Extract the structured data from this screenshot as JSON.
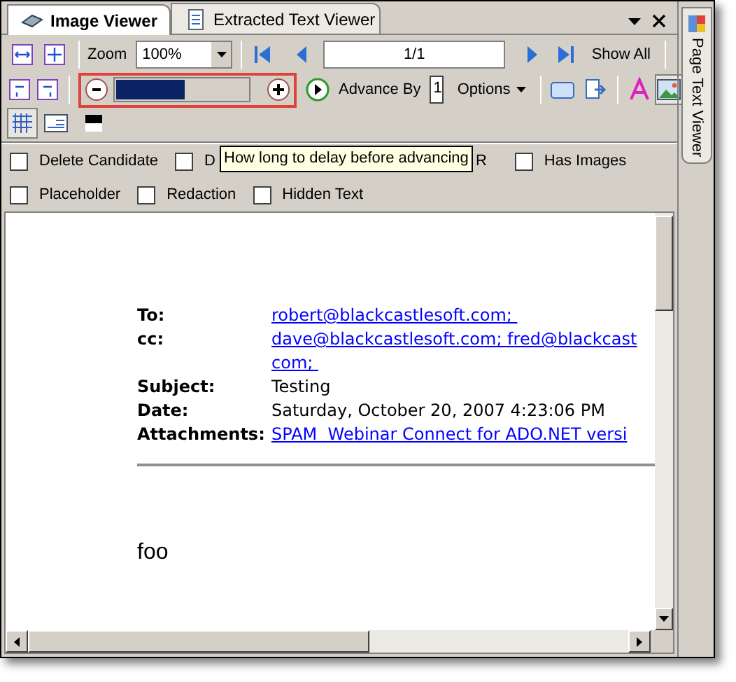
{
  "tabs": [
    {
      "label": "Image Viewer",
      "selected": true
    },
    {
      "label": "Extracted Text Viewer",
      "selected": false
    }
  ],
  "toolbar": {
    "zoom_label": "Zoom",
    "zoom_value": "100%",
    "page_value": "1/1",
    "show_all": "Show All",
    "delay": {
      "level": 0.52
    },
    "advance_label": "Advance By",
    "advance_value": "1",
    "options": "Options",
    "image_button": {
      "selected": true
    }
  },
  "tooltip": "How long to delay before advancing",
  "filter_rows": [
    [
      {
        "kind": "checkbox",
        "label": "Delete Candidate",
        "checked": false
      },
      {
        "kind": "checkbox",
        "label": "D",
        "checked": false
      },
      {
        "kind": "fragment",
        "label": "R"
      },
      {
        "kind": "checkbox",
        "label": "Has Images",
        "checked": false
      }
    ],
    [
      {
        "kind": "checkbox",
        "label": "Placeholder",
        "checked": false
      },
      {
        "kind": "checkbox",
        "label": "Redaction",
        "checked": false
      },
      {
        "kind": "checkbox",
        "label": "Hidden Text",
        "checked": false
      }
    ]
  ],
  "email": {
    "fields": [
      {
        "label": "To:",
        "kind": "link",
        "lines": [
          "robert@blackcastlesoft.com; "
        ]
      },
      {
        "label": "cc:",
        "kind": "link",
        "lines": [
          "dave@blackcastlesoft.com; fred@blackcast",
          "com; "
        ]
      },
      {
        "label": "Subject:",
        "kind": "text",
        "lines": [
          "Testing"
        ]
      },
      {
        "label": "Date:",
        "kind": "text",
        "lines": [
          "Saturday, October 20, 2007 4:23:06 PM"
        ]
      },
      {
        "label": "Attachments:",
        "kind": "link",
        "lines": [
          "SPAM  Webinar Connect for ADO.NET versi"
        ]
      }
    ],
    "body": "foo"
  },
  "side_panel": {
    "title": "Page Text Viewer"
  }
}
